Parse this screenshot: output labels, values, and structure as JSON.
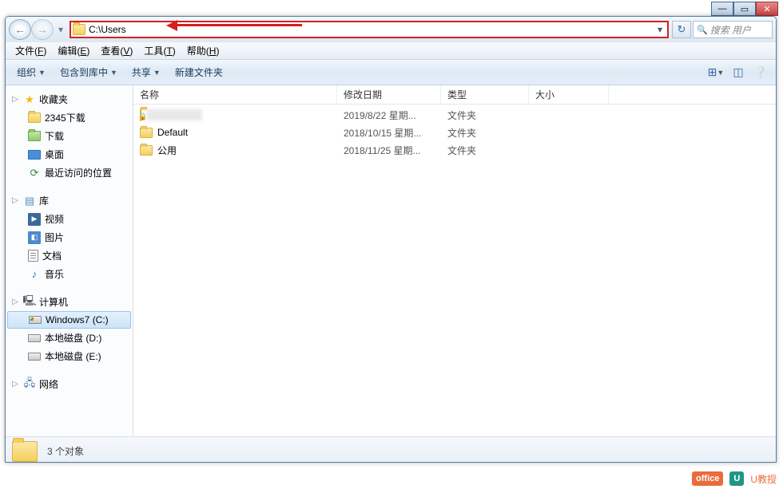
{
  "window_controls": {
    "min": "—",
    "max": "▭",
    "close": "✕"
  },
  "nav": {
    "back": "←",
    "forward": "→",
    "dropdown": "▾"
  },
  "address": {
    "path": "C:\\Users",
    "dropdown": "▾",
    "refresh": "↻"
  },
  "search": {
    "placeholder": "搜索 用户",
    "icon": "🔍"
  },
  "menubar": [
    {
      "label": "文件",
      "key": "F"
    },
    {
      "label": "编辑",
      "key": "E"
    },
    {
      "label": "查看",
      "key": "V"
    },
    {
      "label": "工具",
      "key": "T"
    },
    {
      "label": "帮助",
      "key": "H"
    }
  ],
  "toolbar": {
    "organize": "组织",
    "include": "包含到库中",
    "share": "共享",
    "newfolder": "新建文件夹",
    "dd": "▼"
  },
  "sidebar": {
    "favorites": {
      "label": "收藏夹",
      "items": [
        "2345下载",
        "下载",
        "桌面",
        "最近访问的位置"
      ]
    },
    "libraries": {
      "label": "库",
      "items": [
        "视频",
        "图片",
        "文档",
        "音乐"
      ]
    },
    "computer": {
      "label": "计算机",
      "items": [
        "Windows7 (C:)",
        "本地磁盘 (D:)",
        "本地磁盘 (E:)"
      ]
    },
    "network": {
      "label": "网络"
    }
  },
  "columns": {
    "name": "名称",
    "date": "修改日期",
    "type": "类型",
    "size": "大小"
  },
  "files": [
    {
      "name": "",
      "blurred": true,
      "locked": true,
      "date": "2019/8/22 星期...",
      "type": "文件夹"
    },
    {
      "name": "Default",
      "date": "2018/10/15 星期...",
      "type": "文件夹"
    },
    {
      "name": "公用",
      "date": "2018/11/25 星期...",
      "type": "文件夹"
    }
  ],
  "statusbar": {
    "text": "3 个对象"
  },
  "watermarks": {
    "a": "office",
    "b": "U",
    "c": "U教授"
  }
}
